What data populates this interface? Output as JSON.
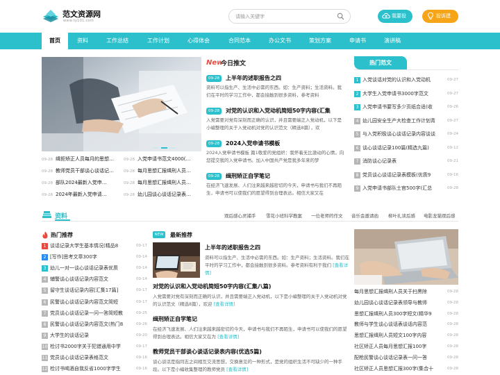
{
  "site": {
    "name": "范文资源网",
    "domain": "www.ty101.com"
  },
  "search": {
    "placeholder": "请输入关键字"
  },
  "header_buttons": {
    "submit": "我要投稿",
    "suggest": "投诉建议"
  },
  "colors": {
    "accent": "#2bc0cb",
    "orange": "#f6a418",
    "red": "#e84a3e",
    "blue": "#2d8cf0"
  },
  "nav": [
    "首页",
    "资料",
    "工作总结",
    "工作计划",
    "心得体会",
    "合同范本",
    "办公文书",
    "策划方案",
    "申请书",
    "演讲稿"
  ],
  "today": {
    "badge": "New",
    "title": "今日推文"
  },
  "banner_list": [
    {
      "d1": "09-28",
      "t1": "缉拒矫正人员每月的思想…",
      "d2": "09-28",
      "t2": "入党申请书范文4000(…"
    },
    {
      "d1": "09-28",
      "t1": "教师党员干部谈心谈话记…",
      "d2": "09-28",
      "t2": "每月思想汇报缉刑人员…"
    },
    {
      "d1": "09-28",
      "t1": "部队2024最新入党申…",
      "d2": "09-28",
      "t2": "每月思想汇报缉刑人员…"
    },
    {
      "d1": "09-28",
      "t1": "2024年最新入党申请…",
      "d2": "09-28",
      "t2": "幼儿园谈心谈话记录表…"
    }
  ],
  "today_posts": [
    {
      "date": "09-28",
      "title": "上半年的述职报告之四",
      "desc": "资料可以指生产、生活中必需的东西。如：生产资料；生活资料。我们在平时的学习工作中，都会接触到很多资料，参考资料"
    },
    {
      "date": "09-28",
      "title": "对党的认识和入党动机简短50字内容(汇集",
      "desc": "入党需要对党有深刻而正确的认识，并且需要端正入党动机，以下是小编整理的关于入党动机对党的认识范文（精选8篇），欢"
    },
    {
      "date": "09-28",
      "title": "2024入党申请书模板",
      "desc": "2024入党申请书模板 篇1敬爱的党组织：我怀着无比激动的心情，向您提交我的入党申请书。加入中国共产党是我多年来的梦"
    },
    {
      "date": "09-28",
      "title": "缉刑矫正自学笔记",
      "desc": "在经济飞速发展、人们注来越来越密切的今天，申请书与我们不再陌生，申请书可以使我们的愿望得到合理表达。相信大家又在"
    }
  ],
  "hot": {
    "title": "热门范文",
    "items": [
      {
        "n": "1",
        "t": "入党谈话对党的认识和入党动机",
        "d": "09-27"
      },
      {
        "n": "2",
        "t": "大学生入党申请书3000字范文",
        "d": "09-27"
      },
      {
        "n": "3",
        "t": "入党申请书要写多少页纸合适(收",
        "d": "09-26"
      },
      {
        "n": "4",
        "t": "幼儿园安全生产大检查工作计划青",
        "d": "09-27"
      },
      {
        "n": "5",
        "t": "与入党积极谈心谈话记录内容谈谈",
        "d": "09-24"
      },
      {
        "n": "6",
        "t": "谈心谈话记录100篇(精选九篇)",
        "d": "09-12"
      },
      {
        "n": "7",
        "t": "消防谈心记录表",
        "d": "09-21"
      },
      {
        "n": "8",
        "t": "党员谈心谈话记录表模板(优质9",
        "d": "09-16"
      },
      {
        "n": "9",
        "t": "入党申请书部队士官500字(汇总",
        "d": "09-28"
      }
    ]
  },
  "section2": {
    "title": "资料",
    "tags": [
      "观后感心灵捕手",
      "雪花小班科学教案",
      "一位老师的作文",
      "音乐会邀请函",
      "柳叶扎读后感",
      "电影龙猫观后感"
    ],
    "hot_rec": "热门推荐",
    "hot_list": [
      {
        "n": "1",
        "t": "谈话记录大学生基本情况(精品8",
        "d": "09-17"
      },
      {
        "n": "2",
        "t": "[写作]思考文章300字",
        "d": "09-14"
      },
      {
        "n": "3",
        "t": "幼儿一对一谈心谈话记录表优质",
        "d": "09-14"
      },
      {
        "n": "4",
        "t": "辅警谈心谈话记录内容范文",
        "d": "09-14"
      },
      {
        "n": "5",
        "t": "留守生谈话记录内容[汇集17篇]",
        "d": "09-17"
      },
      {
        "n": "6",
        "t": "民警谈心谈话记录内容范文简短",
        "d": "09-17"
      },
      {
        "n": "7",
        "t": "党员谈心谈话记录一问一答简短教",
        "d": "09-25"
      },
      {
        "n": "8",
        "t": "民警谈心谈话记录内容范文(热门8",
        "d": "09-26"
      },
      {
        "n": "9",
        "t": "大学生的谈话记录",
        "d": "09-20"
      },
      {
        "n": "10",
        "t": "检讨书2000字关于犯错通用中学",
        "d": "09-17"
      },
      {
        "n": "11",
        "t": "党员谈心谈话记录表格范文",
        "d": "09-16"
      },
      {
        "n": "12",
        "t": "检讨书喝酒自我反省1000字学生",
        "d": "09-16"
      }
    ],
    "latest": {
      "badge": "NEW",
      "title": "最新推荐"
    },
    "feature": {
      "title": "上半年的述职报告之四",
      "desc": "资料可以指生产、生活中必需的东西。如：生产资料；生活资料。我们在平时的学习工作中，都会接触到很多资料。参考资料有利于我们",
      "more": "[查看详情]"
    },
    "posts": [
      {
        "title": "对党的认识和入党动机简短50字内容(汇集八篇)",
        "desc": "入党需要对党有深刻而正确的认识，并且需要端正入党动机，以下是小编整理的关于入党动机对党的认识范文（精选8篇），欢迎",
        "more": "[查看详情]"
      },
      {
        "title": "缉刑矫正自学笔记",
        "desc": "在经济飞速发展、人们注来越来越密切的今天，申请书与我们不再陌生，申请书可以使我们的愿望得到合理表达。相信大家又在为",
        "more": "[查看详情]"
      },
      {
        "title": "教师党员干部谈心谈话记录表内容(优选5篇)",
        "desc": "谈心谈话是指同志之间相互交流思想，交换意见的一种形式，是党的组织生活不可缺少的一种手段。以下是小编收集整理的教师党员",
        "more": "[查看详情]"
      }
    ],
    "right_list": [
      {
        "t": "每月思想汇报缉刑人员关于扫黑除",
        "d": "09-28"
      },
      {
        "t": "幼儿园谈心谈话记录表领导与教师",
        "d": "09-28"
      },
      {
        "t": "思想汇报缉刑人员300字短文(精华9",
        "d": "09-28"
      },
      {
        "t": "教师与学生谈心谈话表谈话内容范",
        "d": "09-28"
      },
      {
        "t": "思想汇报缉刑人员短文100字内容",
        "d": "09-28"
      },
      {
        "t": "社区矫正人员每月思想汇报100字",
        "d": "09-28"
      },
      {
        "t": "配枪民警谈心谈话记录表一问一答",
        "d": "09-28"
      },
      {
        "t": "社区矫正人员思想汇报300字(集合十",
        "d": "09-28"
      }
    ]
  }
}
